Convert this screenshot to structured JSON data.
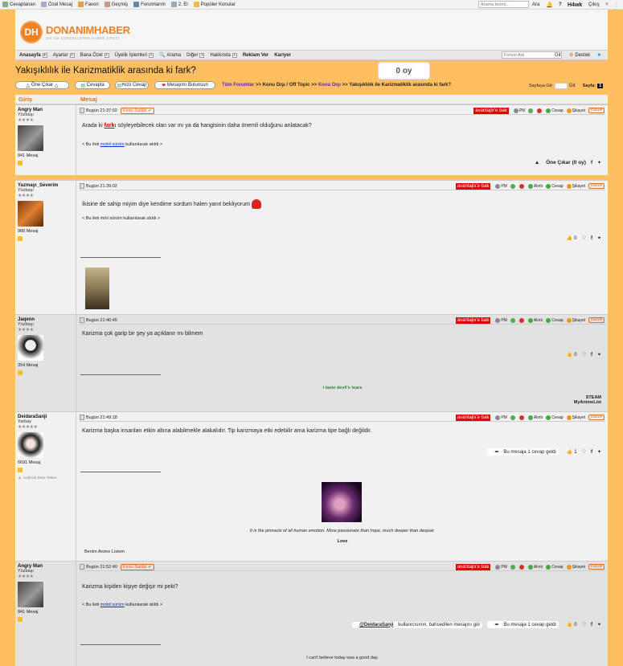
{
  "topbar": {
    "items": [
      "Cevaplanan",
      "Özel Mesaj",
      "Favori",
      "Geçmiş",
      "Forumlarım",
      "2. El",
      "Popüler Konular"
    ],
    "search_placeholder": "Arama terimi...",
    "search_btn": "Ara",
    "help": "?",
    "user": "H4wk",
    "logout": "Çıkış"
  },
  "logo": {
    "mark": "DH",
    "name": "DONANIMHABER",
    "tagline": "SIK SIK GÜNCELLENEN HABER SİTESİ"
  },
  "nav": {
    "items": [
      "Anasayfa",
      "Ayarlar",
      "Bana Özel",
      "Üyelik İşlemleri",
      "Arama",
      "Diğer",
      "Hakkında",
      "Reklam Ver",
      "Kariyer"
    ],
    "forum_placeholder": "Forum Adı",
    "go": "Git",
    "support": "Destek"
  },
  "thread": {
    "title": "Yakışıklılık ile Karizmatiklik arasında ki fark?",
    "vote": "0 oy"
  },
  "actions": {
    "highlight": "Öne Çıkar",
    "reply": "Cevapla",
    "quick_reply": "Hızlı Cevap",
    "find_msg": "Mesajımı Bulunsun"
  },
  "breadcrumb": {
    "all": "Tüm Forumlar",
    "sep": ">>",
    "cat": "Konu Dışı / Off Topic",
    "sub": "Konu Dışı",
    "current": "Yakışıklılık ile Karizmatiklik arasında ki fark?"
  },
  "paging": {
    "goto": "Sayfaya Git:",
    "go": "Git",
    "page_label": "Sayfa:",
    "page": "1"
  },
  "table": {
    "col1": "Giriş",
    "col2": "Mesaj"
  },
  "post_tools": {
    "bak": "avantajix'e bak",
    "pm": "PM",
    "alinti": "Alıntı",
    "cevap": "Cevap",
    "sikayet": "Şikayet",
    "daha": "Daha",
    "owner": "Konu Sahibi"
  },
  "posts": [
    {
      "user": "Angry Man",
      "rank": "Yüzbaşı",
      "stars": "★★★★",
      "msgs": "841 Mesaj",
      "time": "Bugün 21:37:02",
      "pre": "Arada ki ",
      "word": "fark",
      "post": "ı söyleyebilecek olan var mı ya da hangisinin daha önemli olduğunu anlatacak?",
      "via_pre": "< Bu ileti ",
      "via_link": "mobil sürüm",
      "via_post": " kullanılarak atıldı >",
      "onecikar": "Öne Çıkar (0 oy)"
    },
    {
      "user": "Yazmayı_Severim",
      "rank": "Yüzbaşı",
      "stars": "★★★★",
      "msgs": "988 Mesaj",
      "time": "Bugün 21:39:02",
      "text": "İkisine de sahip miyim diye kendime sordum halen yanıt bekliyorum",
      "via": "< Bu ileti mini sürüm kullanılarak atıldı >",
      "likes": "0"
    },
    {
      "user": "Jaqenn",
      "rank": "Yüzbaşı",
      "stars": "★★★★",
      "msgs": "354 Mesaj",
      "time": "Bugün 21:40:45",
      "text": "Karizma çok garip bir şey ya açıklanır mı bilmem",
      "likes": "0",
      "sig": "i taste devil's tears",
      "steam": "STEAM",
      "mal": "MyAnimeList"
    },
    {
      "user": "DeidaraSanji",
      "rank": "Yarbay",
      "stars": "★★★★★",
      "msgs": "6691 Mesaj",
      "time": "Bugün 21:49:18",
      "text": "Karizma başka insanları etkin altına alabilmekle alakalıdır. Tip karizmaya etki edebilir ama karizma tipe bağlı değildir.",
      "replies": "Bu mesaja 1 cevap geldi",
      "likes": "1",
      "beta": "Android Beta Tester",
      "quote": "It is the pinnacle of all human emotion. More passionate than hope, much deeper than despair.",
      "love": "Love",
      "list": "Benim Anime Listem"
    },
    {
      "user": "Angry Man",
      "rank": "Yüzbaşı",
      "stars": "★★★★",
      "msgs": "841 Mesaj",
      "time": "Bugün 21:52:40",
      "text": "Karizma kişiden kişiye değişir mi peki?",
      "via_pre": "< Bu ileti ",
      "via_link": "mobil sürüm",
      "via_post": " kullanılarak atıldı >",
      "mention_user": "@DeidaraSanji",
      "mention_text": " kullanıcısının, bahsedilen mesajını gör",
      "replies": "Bu mesaja 1 cevap geldi",
      "likes": "0",
      "sig": "I can't believe today was a good day."
    }
  ]
}
